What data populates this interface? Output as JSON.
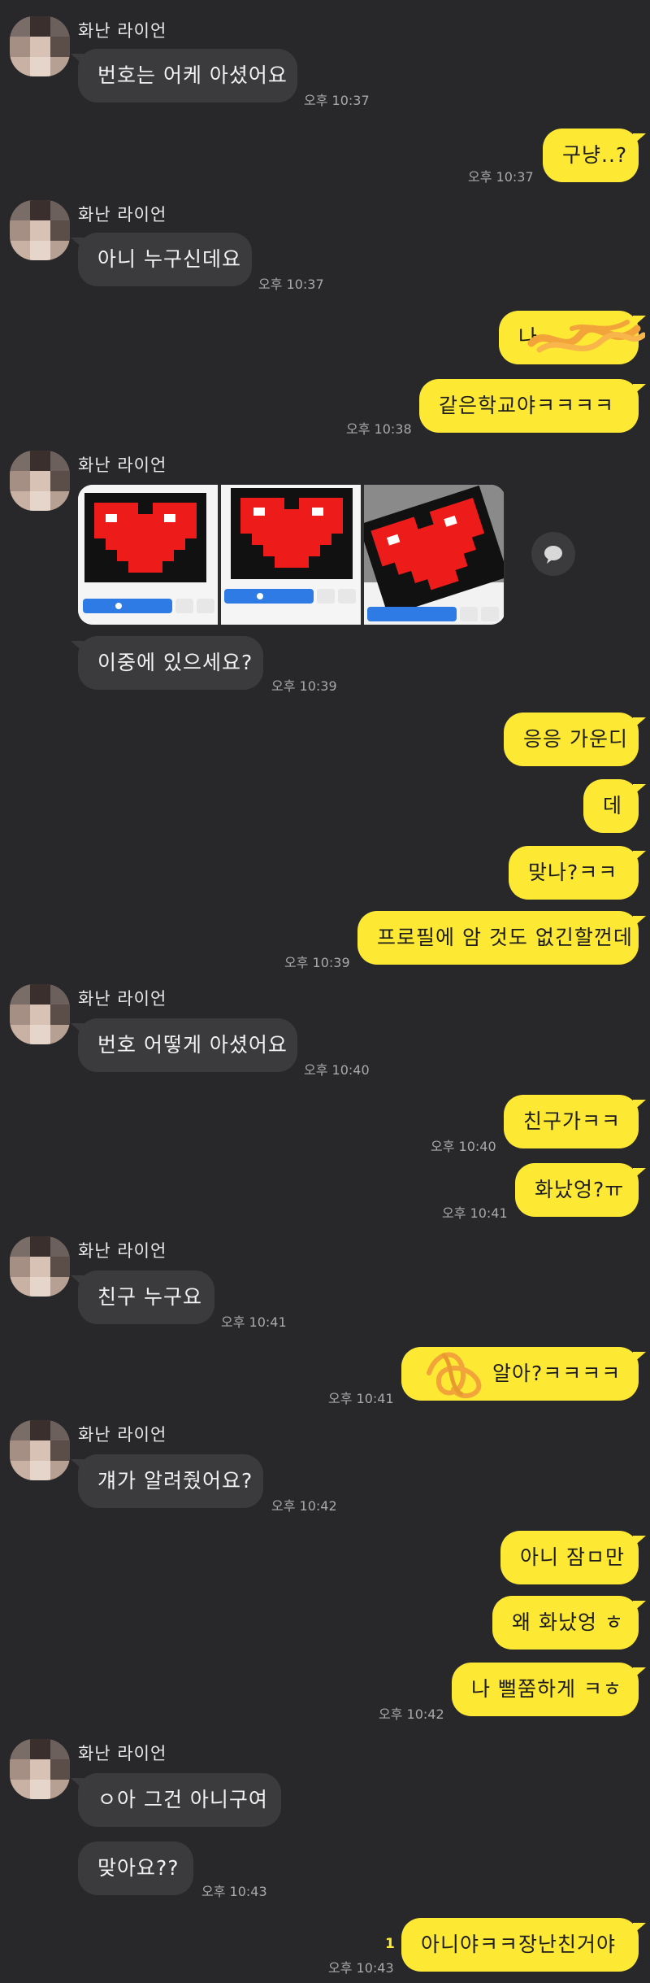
{
  "contact_name": "화난 라이언",
  "colors": {
    "background": "#28282a",
    "my_bubble": "#fde934",
    "their_bubble": "#3b3b3d",
    "unread": "#fde934"
  },
  "messages": [
    {
      "id": 1,
      "text": "번호는 어케 아셨어요",
      "time": "오후 10:37"
    },
    {
      "id": 2,
      "text": "구냥..?",
      "time": "오후 10:37"
    },
    {
      "id": 3,
      "text": "아니 누구신데요",
      "time": "오후 10:37"
    },
    {
      "id": 4,
      "text": "나 ",
      "time": ""
    },
    {
      "id": 5,
      "text": "같은학교야ㅋㅋㅋㅋ",
      "time": "오후 10:38"
    },
    {
      "id": 6,
      "text": "이중에 있으세요?",
      "time": "오후 10:39"
    },
    {
      "id": 7,
      "text": "응응 가운디",
      "time": ""
    },
    {
      "id": 8,
      "text": "데",
      "time": ""
    },
    {
      "id": 9,
      "text": "맞나?ㅋㅋ",
      "time": ""
    },
    {
      "id": 10,
      "text": "프로필에 암 것도 없긴할껀데",
      "time": "오후 10:39"
    },
    {
      "id": 11,
      "text": "번호 어떻게 아셨어요",
      "time": "오후 10:40"
    },
    {
      "id": 12,
      "text": "친구가ㅋㅋ",
      "time": "오후 10:40"
    },
    {
      "id": 13,
      "text": "화났엉?ㅠ",
      "time": "오후 10:41"
    },
    {
      "id": 14,
      "text": "친구 누구요",
      "time": "오후 10:41"
    },
    {
      "id": 15,
      "text": "알아?ㅋㅋㅋㅋ",
      "time": "오후 10:41"
    },
    {
      "id": 16,
      "text": "걔가 알려줬어요?",
      "time": "오후 10:42"
    },
    {
      "id": 17,
      "text": "아니 잠ㅁ만",
      "time": ""
    },
    {
      "id": 18,
      "text": "왜 화났엉 ㅎ",
      "time": ""
    },
    {
      "id": 19,
      "text": "나 뻘쭘하게 ㅋㅎ",
      "time": "오후 10:42"
    },
    {
      "id": 20,
      "text": "ㅇ아 그건 아니구여",
      "time": ""
    },
    {
      "id": 21,
      "text": "맞아요??",
      "time": "오후 10:43"
    },
    {
      "id": 22,
      "text": "아니야ㅋㅋ장난친거야",
      "time": "오후 10:43",
      "unread": "1"
    }
  ]
}
